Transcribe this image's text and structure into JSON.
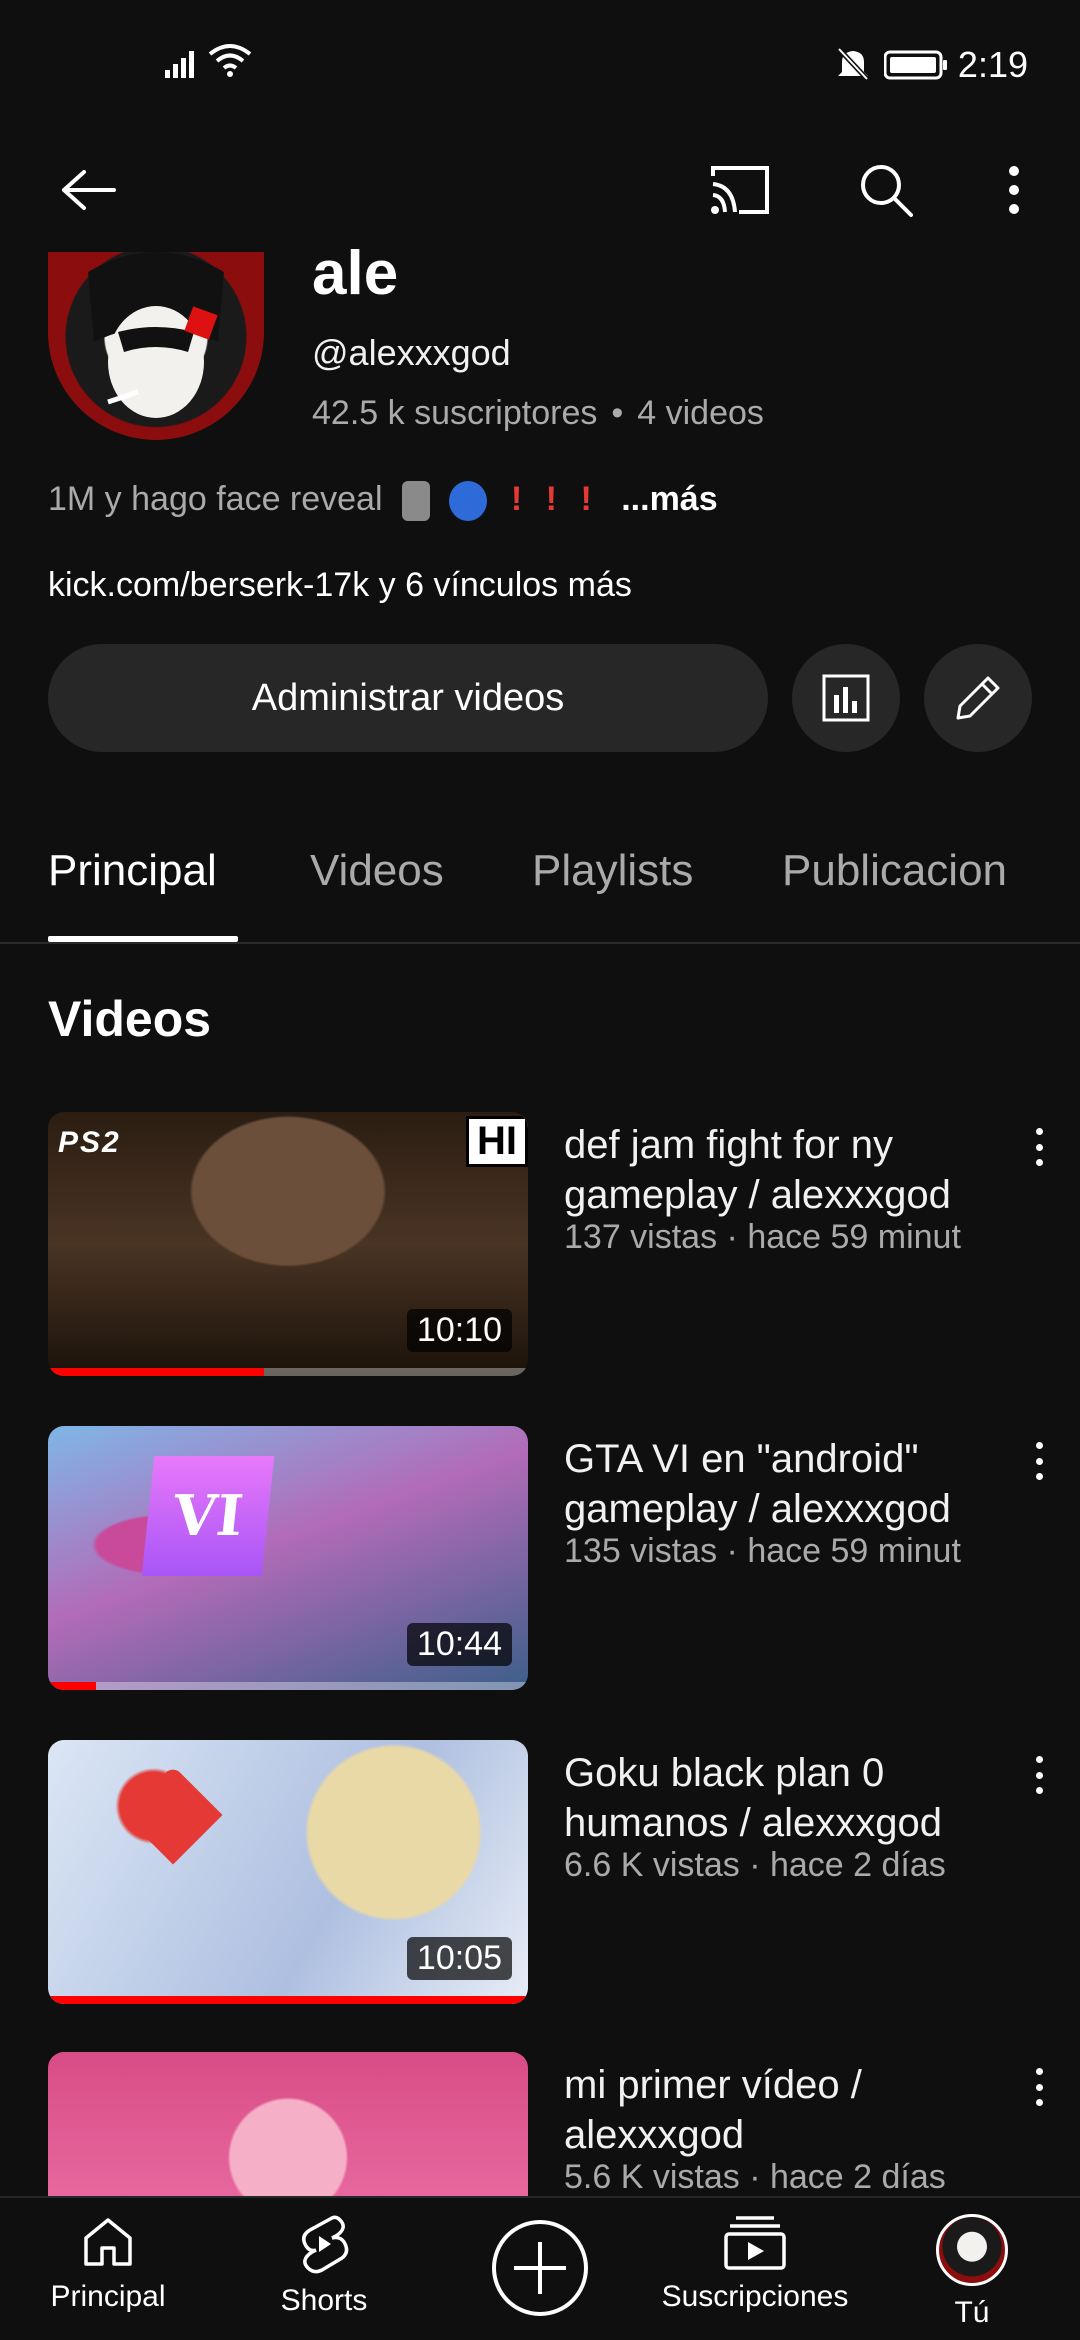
{
  "status_bar": {
    "time": "2:19"
  },
  "channel": {
    "name": "ale",
    "handle": "@alexxxgod",
    "subscribers": "42.5 k suscriptores",
    "separator": "•",
    "video_count": "4 videos",
    "description": "1M y hago face reveal",
    "description_more": "...más",
    "link_main": "kick.com/berserk-17k",
    "link_extra": " y 6 vínculos más"
  },
  "actions": {
    "manage_label": "Administrar videos"
  },
  "tabs": [
    {
      "label": "Principal",
      "active": true
    },
    {
      "label": "Videos"
    },
    {
      "label": "Playlists"
    },
    {
      "label": "Publicacion"
    }
  ],
  "section": {
    "title": "Videos"
  },
  "videos": [
    {
      "title": "def jam fight for ny gameplay / alexxxgod",
      "views": "137 vistas",
      "dot": "·",
      "age": "hace 59 minut",
      "duration": "10:10",
      "progress": 0.45
    },
    {
      "title": "GTA VI en \"android\" gameplay / alexxxgod",
      "views": "135 vistas",
      "dot": "·",
      "age": "hace 59 minut",
      "duration": "10:44",
      "progress": 0.1
    },
    {
      "title": "Goku black plan 0 humanos / alexxxgod",
      "views": "6.6 K vistas",
      "dot": "·",
      "age": "hace 2 días",
      "duration": "10:05",
      "progress": 1.0
    },
    {
      "title": "mi primer vídeo / alexxxgod",
      "views": "5.6 K vistas",
      "dot": "·",
      "age": "hace 2 días"
    }
  ],
  "thumb_text": {
    "ps2": "PS2",
    "hd": "HI",
    "gta": "VI"
  },
  "bottom_nav": {
    "home": "Principal",
    "shorts": "Shorts",
    "subscriptions": "Suscripciones",
    "you": "Tú"
  },
  "colors": {
    "background": "#0f0f0f",
    "accent": "#ff0000",
    "secondary_text": "#aaaaaa"
  }
}
